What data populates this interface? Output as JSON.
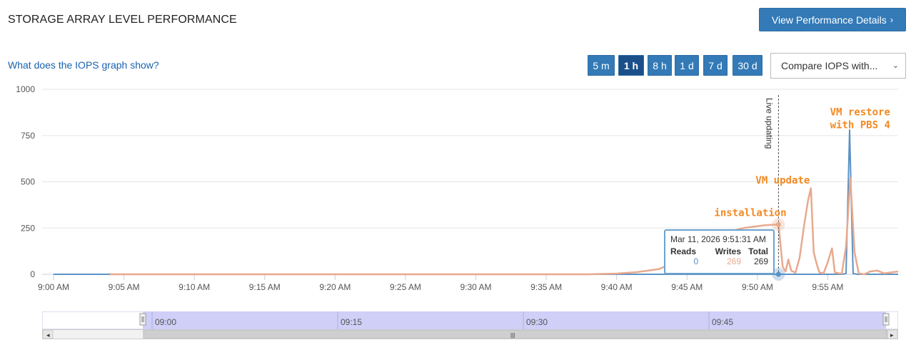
{
  "header": {
    "title": "STORAGE ARRAY LEVEL PERFORMANCE",
    "details_button": "View Performance Details",
    "help_link": "What does the IOPS graph show?"
  },
  "time_ranges": [
    {
      "label": "5 m",
      "active": false
    },
    {
      "label": "1 h",
      "active": true
    },
    {
      "label": "8 h",
      "active": false
    },
    {
      "label": "1 d",
      "active": false
    },
    {
      "label": "7 d",
      "active": false
    },
    {
      "label": "30 d",
      "active": false
    }
  ],
  "compare": {
    "label": "Compare IOPS with...",
    "caret": "⌄"
  },
  "colors": {
    "reads": "#5b92c5",
    "writes": "#e8a98e",
    "annotation": "#f28a24",
    "accent": "#337ab7"
  },
  "chart_data": {
    "type": "line",
    "x_tick_labels": [
      "9:00 AM",
      "9:05 AM",
      "9:10 AM",
      "9:15 AM",
      "9:20 AM",
      "9:25 AM",
      "9:30 AM",
      "9:35 AM",
      "9:40 AM",
      "9:45 AM",
      "9:50 AM",
      "9:55 AM"
    ],
    "y_tick_labels": [
      "0",
      "250",
      "500",
      "750",
      "1000"
    ],
    "ylim": [
      0,
      1000
    ],
    "xlim_minutes": [
      0,
      60
    ],
    "live_label": "Live updating",
    "live_at_minute": 51.5,
    "series": [
      {
        "key": "reads",
        "points": [
          [
            0,
            0
          ],
          [
            51,
            0
          ],
          [
            56,
            0
          ],
          [
            56.3,
            4
          ],
          [
            56.55,
            780
          ],
          [
            56.8,
            4
          ],
          [
            57.1,
            0
          ],
          [
            60,
            0
          ]
        ]
      },
      {
        "key": "writes",
        "points": [
          [
            4,
            0
          ],
          [
            38,
            0
          ],
          [
            40,
            4
          ],
          [
            41.5,
            12
          ],
          [
            43,
            28
          ],
          [
            44.5,
            75
          ],
          [
            46,
            165
          ],
          [
            47.5,
            220
          ],
          [
            49,
            250
          ],
          [
            50.5,
            265
          ],
          [
            51.5,
            269
          ],
          [
            51.8,
            40
          ],
          [
            52,
            15
          ],
          [
            52.2,
            80
          ],
          [
            52.4,
            20
          ],
          [
            52.7,
            8
          ],
          [
            53,
            90
          ],
          [
            53.3,
            255
          ],
          [
            53.6,
            400
          ],
          [
            53.8,
            465
          ],
          [
            54.0,
            120
          ],
          [
            54.2,
            60
          ],
          [
            54.4,
            10
          ],
          [
            54.7,
            5
          ],
          [
            55,
            65
          ],
          [
            55.3,
            140
          ],
          [
            55.5,
            10
          ],
          [
            55.8,
            5
          ],
          [
            56,
            4
          ],
          [
            56.3,
            150
          ],
          [
            56.6,
            520
          ],
          [
            56.9,
            120
          ],
          [
            57.2,
            5
          ],
          [
            57.6,
            0
          ],
          [
            58,
            15
          ],
          [
            58.5,
            20
          ],
          [
            59,
            5
          ],
          [
            59.5,
            10
          ],
          [
            60,
            15
          ]
        ]
      }
    ],
    "annotations": [
      {
        "text": "installation",
        "at": [
          49.5,
          315
        ]
      },
      {
        "text": "VM update",
        "at": [
          51.8,
          490
        ]
      },
      {
        "text": "VM restore",
        "at": [
          57.3,
          860
        ]
      },
      {
        "text": "with PBS 4",
        "at": [
          57.3,
          790
        ]
      }
    ]
  },
  "tooltip": {
    "date": "Mar 11, 2026 9:51:31 AM",
    "headers": [
      "Reads",
      "Writes",
      "Total"
    ],
    "values": [
      "0",
      "269",
      "269"
    ]
  },
  "navigator": {
    "labels": [
      "09:00",
      "09:15",
      "09:30",
      "09:45"
    ],
    "handle_glyph": "|||",
    "left_arrow": "◂",
    "right_arrow": "▸"
  }
}
